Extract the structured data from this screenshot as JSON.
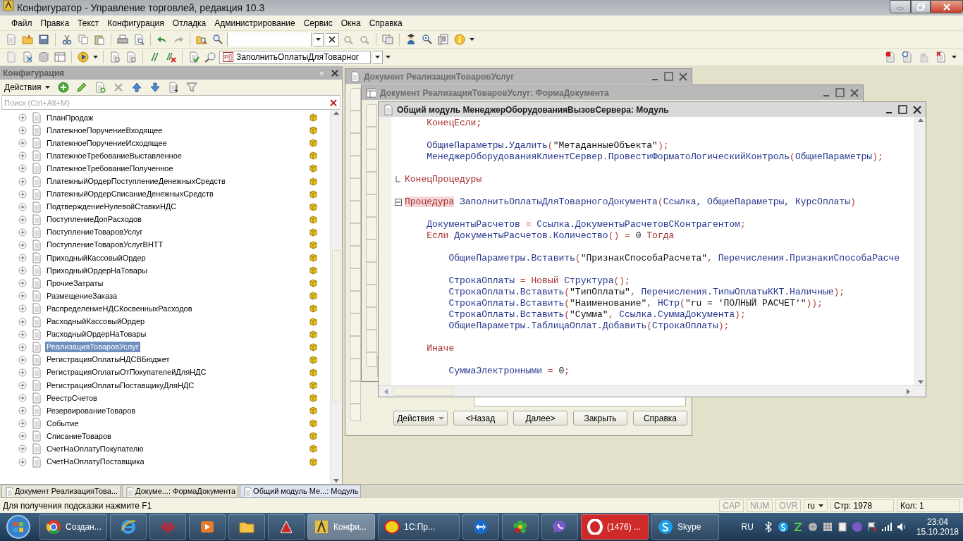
{
  "window": {
    "title": "Конфигуратор - Управление торговлей, редакция 10.3"
  },
  "menu": [
    "Файл",
    "Правка",
    "Текст",
    "Конфигурация",
    "Отладка",
    "Администрирование",
    "Сервис",
    "Окна",
    "Справка"
  ],
  "toolbar": {
    "procedure_combo": {
      "badge": "P[]",
      "value": "ЗаполнитьОплатыДляТоварног"
    }
  },
  "config_panel": {
    "title": "Конфигурация",
    "actions_label": "Действия",
    "search": {
      "placeholder": "Поиск (Ctrl+Alt+M)"
    },
    "items": [
      {
        "label": "ПланПродаж",
        "expanded": false,
        "selected": false
      },
      {
        "label": "ПлатежноеПоручениеВходящее",
        "expanded": false,
        "selected": false
      },
      {
        "label": "ПлатежноеПоручениеИсходящее",
        "expanded": false,
        "selected": false
      },
      {
        "label": "ПлатежноеТребованиеВыставленное",
        "expanded": false,
        "selected": false
      },
      {
        "label": "ПлатежноеТребованиеПолученное",
        "expanded": false,
        "selected": false
      },
      {
        "label": "ПлатежныйОрдерПоступлениеДенежныхСредств",
        "expanded": false,
        "selected": false
      },
      {
        "label": "ПлатежныйОрдерСписаниеДенежныхСредств",
        "expanded": false,
        "selected": false
      },
      {
        "label": "ПодтверждениеНулевойСтавкиНДС",
        "expanded": false,
        "selected": false
      },
      {
        "label": "ПоступлениеДопРасходов",
        "expanded": false,
        "selected": false
      },
      {
        "label": "ПоступлениеТоваровУслуг",
        "expanded": false,
        "selected": false
      },
      {
        "label": "ПоступлениеТоваровУслугВНТТ",
        "expanded": false,
        "selected": false
      },
      {
        "label": "ПриходныйКассовыйОрдер",
        "expanded": false,
        "selected": false
      },
      {
        "label": "ПриходныйОрдерНаТовары",
        "expanded": false,
        "selected": false
      },
      {
        "label": "ПрочиеЗатраты",
        "expanded": false,
        "selected": false
      },
      {
        "label": "РазмещениеЗаказа",
        "expanded": false,
        "selected": false
      },
      {
        "label": "РаспределениеНДСКосвенныхРасходов",
        "expanded": false,
        "selected": false
      },
      {
        "label": "РасходныйКассовыйОрдер",
        "expanded": false,
        "selected": false
      },
      {
        "label": "РасходныйОрдерНаТовары",
        "expanded": false,
        "selected": false
      },
      {
        "label": "РеализацияТоваровУслуг",
        "expanded": false,
        "selected": true
      },
      {
        "label": "РегистрацияОплатыНДСВБюджет",
        "expanded": false,
        "selected": false
      },
      {
        "label": "РегистрацияОплатыОтПокупателейДляНДС",
        "expanded": false,
        "selected": false
      },
      {
        "label": "РегистрацияОплатыПоставщикуДляНДС",
        "expanded": false,
        "selected": false
      },
      {
        "label": "РеестрСчетов",
        "expanded": false,
        "selected": false
      },
      {
        "label": "РезервированиеТоваров",
        "expanded": false,
        "selected": false
      },
      {
        "label": "Событие",
        "expanded": false,
        "selected": false
      },
      {
        "label": "СписаниеТоваров",
        "expanded": false,
        "selected": false
      },
      {
        "label": "СчетНаОплатуПокупателю",
        "expanded": false,
        "selected": false
      },
      {
        "label": "СчетНаОплатуПоставщика",
        "expanded": false,
        "selected": false
      }
    ]
  },
  "windows": [
    {
      "title": "Документ РеализацияТоваровУслуг",
      "active": false,
      "buttons": [
        {
          "label": "Действия",
          "kind": "menu"
        },
        {
          "label": "<Назад",
          "kind": "plain"
        },
        {
          "label": "Далее>",
          "kind": "plain"
        },
        {
          "label": "Закрыть",
          "kind": "plain"
        },
        {
          "label": "Справка",
          "kind": "plain"
        }
      ]
    },
    {
      "title": "Документ РеализацияТоваровУслуг: ФормаДокумента",
      "active": false
    },
    {
      "title": "Общий модуль МенеджерОборудованияВызовСервера: Модуль",
      "active": true,
      "code_lines": [
        {
          "kind": "code",
          "segments": [
            {
              "kind": "kw",
              "text": "    КонецЕсли;"
            }
          ]
        },
        {
          "kind": "blank"
        },
        {
          "kind": "code",
          "segments": [
            {
              "kind": "id",
              "text": "    ОбщиеПараметры.Удалить"
            },
            {
              "kind": "op",
              "text": "("
            },
            {
              "kind": "str",
              "text": "\"МетаданныеОбъекта\""
            },
            {
              "kind": "op",
              "text": ");"
            }
          ]
        },
        {
          "kind": "code",
          "segments": [
            {
              "kind": "id",
              "text": "    МенеджерОборудованияКлиентСервер.ПровестиФорматоЛогическийКонтроль"
            },
            {
              "kind": "op",
              "text": "("
            },
            {
              "kind": "id",
              "text": "ОбщиеПараметры"
            },
            {
              "kind": "op",
              "text": ");"
            }
          ]
        },
        {
          "kind": "blank"
        },
        {
          "kind": "code",
          "block_end": true,
          "segments": [
            {
              "kind": "kw",
              "text": "КонецПроцедуры"
            }
          ]
        },
        {
          "kind": "blank"
        },
        {
          "kind": "code",
          "fold_expanded": true,
          "segments": [
            {
              "kind": "kw",
              "text": "Процедура",
              "highlighted": true
            },
            {
              "kind": "id",
              "text": " ЗаполнитьОплатыДляТоварногоДокумента"
            },
            {
              "kind": "op",
              "text": "("
            },
            {
              "kind": "id",
              "text": "Ссылка, ОбщиеПараметры, КурсОплаты"
            },
            {
              "kind": "op",
              "text": ")"
            }
          ]
        },
        {
          "kind": "blank"
        },
        {
          "kind": "code",
          "segments": [
            {
              "kind": "id",
              "text": "    ДокументыРасчетов "
            },
            {
              "kind": "op",
              "text": "="
            },
            {
              "kind": "id",
              "text": " Ссылка.ДокументыРасчетовСКонтрагентом"
            },
            {
              "kind": "op",
              "text": ";"
            }
          ]
        },
        {
          "kind": "code",
          "segments": [
            {
              "kind": "kw",
              "text": "    Если"
            },
            {
              "kind": "id",
              "text": " ДокументыРасчетов.Количество"
            },
            {
              "kind": "op",
              "text": "() ="
            },
            {
              "kind": "str",
              "text": " 0 "
            },
            {
              "kind": "kw",
              "text": "Тогда"
            }
          ]
        },
        {
          "kind": "blank"
        },
        {
          "kind": "code",
          "segments": [
            {
              "kind": "id",
              "text": "        ОбщиеПараметры.Вставить"
            },
            {
              "kind": "op",
              "text": "("
            },
            {
              "kind": "str",
              "text": "\"ПризнакСпособаРасчета\""
            },
            {
              "kind": "op",
              "text": ","
            },
            {
              "kind": "id",
              "text": " Перечисления.ПризнакиСпособаРасче"
            }
          ]
        },
        {
          "kind": "blank"
        },
        {
          "kind": "code",
          "segments": [
            {
              "kind": "id",
              "text": "        СтрокаОплаты "
            },
            {
              "kind": "op",
              "text": "="
            },
            {
              "kind": "kw",
              "text": " Новый"
            },
            {
              "kind": "id",
              "text": " Структура"
            },
            {
              "kind": "op",
              "text": "();"
            }
          ]
        },
        {
          "kind": "code",
          "segments": [
            {
              "kind": "id",
              "text": "        СтрокаОплаты.Вставить"
            },
            {
              "kind": "op",
              "text": "("
            },
            {
              "kind": "str",
              "text": "\"ТипОплаты\""
            },
            {
              "kind": "op",
              "text": ","
            },
            {
              "kind": "id",
              "text": " Перечисления.ТипыОплатыККТ.Наличные"
            },
            {
              "kind": "op",
              "text": ");"
            }
          ]
        },
        {
          "kind": "code",
          "segments": [
            {
              "kind": "id",
              "text": "        СтрокаОплаты.Вставить"
            },
            {
              "kind": "op",
              "text": "("
            },
            {
              "kind": "str",
              "text": "\"Наименование\""
            },
            {
              "kind": "op",
              "text": ","
            },
            {
              "kind": "id",
              "text": " НСтр"
            },
            {
              "kind": "op",
              "text": "("
            },
            {
              "kind": "str",
              "text": "\"ru = 'ПОЛНЫЙ РАСЧЕТ'\""
            },
            {
              "kind": "op",
              "text": "));"
            }
          ]
        },
        {
          "kind": "code",
          "segments": [
            {
              "kind": "id",
              "text": "        СтрокаОплаты.Вставить"
            },
            {
              "kind": "op",
              "text": "("
            },
            {
              "kind": "str",
              "text": "\"Сумма\""
            },
            {
              "kind": "op",
              "text": ","
            },
            {
              "kind": "id",
              "text": " Ссылка.СуммаДокумента"
            },
            {
              "kind": "op",
              "text": ");"
            }
          ]
        },
        {
          "kind": "code",
          "segments": [
            {
              "kind": "id",
              "text": "        ОбщиеПараметры.ТаблицаОплат.Добавить"
            },
            {
              "kind": "op",
              "text": "("
            },
            {
              "kind": "id",
              "text": "СтрокаОплаты"
            },
            {
              "kind": "op",
              "text": ");"
            }
          ]
        },
        {
          "kind": "blank"
        },
        {
          "kind": "code",
          "segments": [
            {
              "kind": "kw",
              "text": "    Иначе"
            }
          ]
        },
        {
          "kind": "blank"
        },
        {
          "kind": "code",
          "segments": [
            {
              "kind": "id",
              "text": "        СуммаЭлектронными "
            },
            {
              "kind": "op",
              "text": "="
            },
            {
              "kind": "str",
              "text": " 0"
            },
            {
              "kind": "op",
              "text": ";"
            }
          ]
        }
      ]
    }
  ],
  "window_tabs": [
    {
      "label": "Документ РеализацияТова...",
      "selected": false
    },
    {
      "label": "Докуме...: ФормаДокумента",
      "selected": false
    },
    {
      "label": "Общий модуль Ме...: Модуль",
      "selected": true
    }
  ],
  "status_bar": {
    "hint": "Для получения подсказки нажмите F1",
    "indicators": [
      {
        "label": "CAP",
        "on": false
      },
      {
        "label": "NUM",
        "on": false
      },
      {
        "label": "OVR",
        "on": false
      }
    ],
    "language": "ru",
    "line": "Стр: 1978",
    "column": "Кол: 1"
  },
  "taskbar": {
    "items": [
      {
        "kind": "chrome",
        "label": "Создан...",
        "active": false
      },
      {
        "kind": "ie",
        "active": false
      },
      {
        "kind": "huawei",
        "active": false
      },
      {
        "kind": "media",
        "active": false
      },
      {
        "kind": "folder",
        "active": false
      },
      {
        "kind": "redapp",
        "active": false
      },
      {
        "kind": "configurator",
        "label": "Конфи...",
        "active": true
      },
      {
        "kind": "onec",
        "label": "1С:Пр...",
        "active": false
      },
      {
        "kind": "teamviewer",
        "active": false
      },
      {
        "kind": "icq",
        "active": false
      },
      {
        "kind": "viber",
        "active": false
      },
      {
        "kind": "opera",
        "label": "(1476) ...",
        "active": false
      },
      {
        "kind": "skype",
        "label": "Skype",
        "active": false
      }
    ],
    "language": "RU",
    "time": "23:04",
    "date": "15.10.2018"
  }
}
